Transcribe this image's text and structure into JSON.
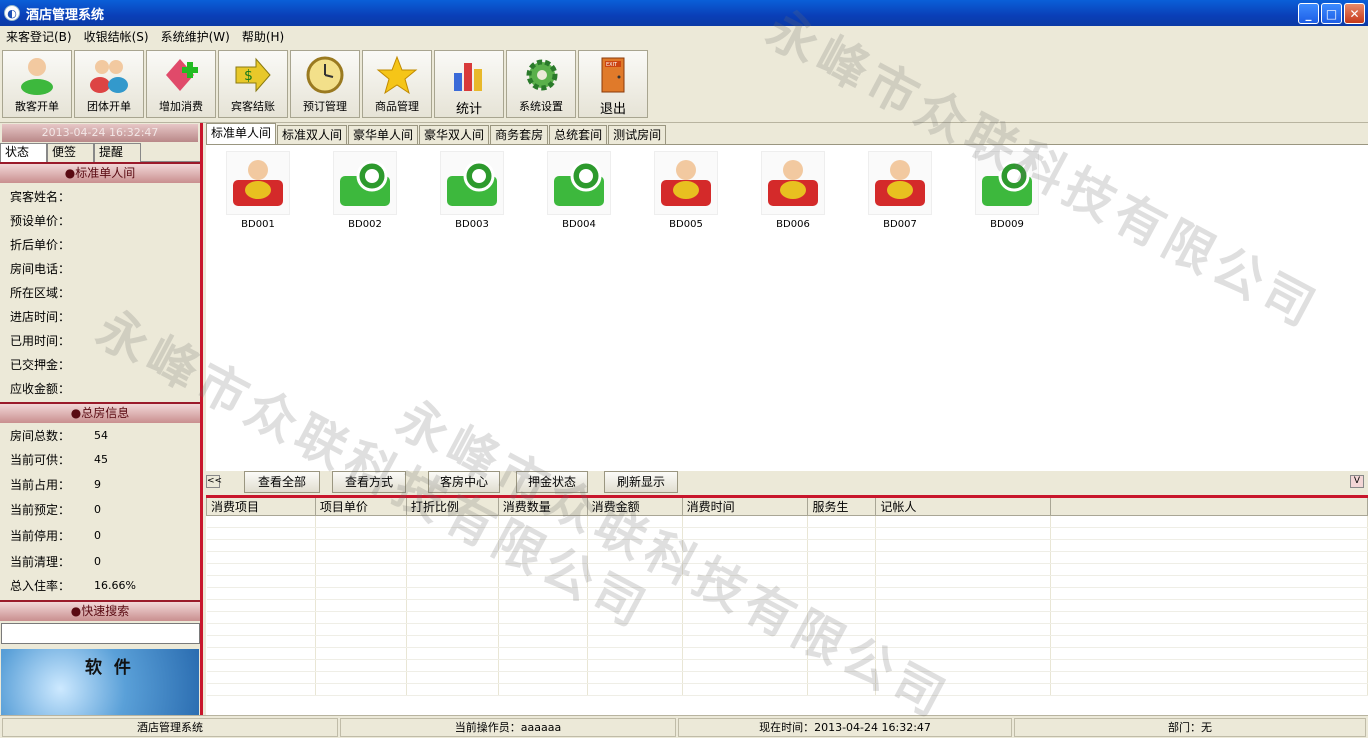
{
  "window": {
    "title": "酒店管理系统",
    "icon": "app-icon",
    "controls": [
      "minimize",
      "maximize",
      "close"
    ]
  },
  "menu": [
    "来客登记(B)",
    "收银结帐(S)",
    "系统维护(W)",
    "帮助(H)"
  ],
  "toolbar": [
    {
      "label": "散客开单",
      "icon": "person-icon"
    },
    {
      "label": "团体开单",
      "icon": "group-icon"
    },
    {
      "label": "增加消费",
      "icon": "add-consume-icon"
    },
    {
      "label": "宾客结账",
      "icon": "checkout-icon"
    },
    {
      "label": "预订管理",
      "icon": "clock-icon"
    },
    {
      "label": "商品管理",
      "icon": "star-icon"
    },
    {
      "label": "统计",
      "icon": "stats-icon"
    },
    {
      "label": "系统设置",
      "icon": "gear-icon"
    },
    {
      "label": "退出",
      "icon": "exit-door-icon"
    }
  ],
  "left": {
    "datetime": "2013-04-24 16:32:47",
    "tabs": [
      "状态",
      "便签",
      "提醒"
    ],
    "room_section": {
      "title": "●标准单人间",
      "fields": [
        "宾客姓名：",
        "预设单价：",
        "折后单价：",
        "房间电话：",
        "所在区域：",
        "进店时间：",
        "已用时间：",
        "已交押金：",
        "应收金额："
      ]
    },
    "summary_section": {
      "title": "●总房信息",
      "fields": [
        {
          "label": "房间总数：",
          "value": "54"
        },
        {
          "label": "当前可供：",
          "value": "45"
        },
        {
          "label": "当前占用：",
          "value": "9"
        },
        {
          "label": "当前预定：",
          "value": "0"
        },
        {
          "label": "当前停用：",
          "value": "0"
        },
        {
          "label": "当前清理：",
          "value": "0"
        },
        {
          "label": "总入住率：",
          "value": "16.66%"
        }
      ]
    },
    "search_section": {
      "title": "●快速搜索",
      "value": ""
    },
    "banner_text": "软 件"
  },
  "room_tabs": [
    "标准单人间",
    "标准双人间",
    "豪华单人间",
    "豪华双人间",
    "商务套房",
    "总统套间",
    "测试房间"
  ],
  "rooms": [
    {
      "name": "BD001",
      "status": "occupied",
      "icon": "occupied-room-icon"
    },
    {
      "name": "BD002",
      "status": "available",
      "icon": "available-room-icon"
    },
    {
      "name": "BD003",
      "status": "available",
      "icon": "available-room-icon"
    },
    {
      "name": "BD004",
      "status": "available",
      "icon": "available-room-icon"
    },
    {
      "name": "BD005",
      "status": "occupied",
      "icon": "occupied-room-icon"
    },
    {
      "name": "BD006",
      "status": "occupied",
      "icon": "occupied-room-icon"
    },
    {
      "name": "BD007",
      "status": "occupied",
      "icon": "occupied-room-icon"
    },
    {
      "name": "BD009",
      "status": "available",
      "icon": "available-room-icon"
    }
  ],
  "bottom_buttons": [
    "查看全部",
    "查看方式",
    "客房中心",
    "押金状态",
    "刷新显示"
  ],
  "collapse_left": "<<",
  "collapse_right": "V",
  "table_columns": [
    "消费项目",
    "项目单价",
    "打折比例",
    "消费数量",
    "消费金额",
    "消费时间",
    "服务生",
    "记帐人"
  ],
  "status_bar": {
    "app": "酒店管理系统",
    "operator": "当前操作员：aaaaaa",
    "time": "现在时间：2013-04-24 16:32:47",
    "department": "部门：无"
  },
  "watermark": "永峰市众联科技有限公司",
  "colors": {
    "accent_red": "#c8162c",
    "title_blue": "#0a4fc8",
    "occupied": "#d42a2a",
    "available": "#3db83d"
  }
}
